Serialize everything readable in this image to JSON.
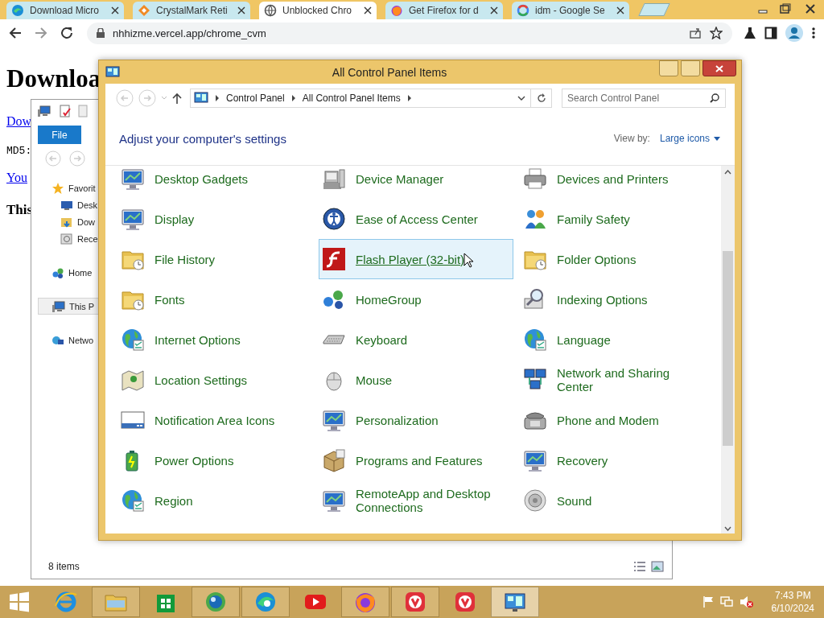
{
  "browser": {
    "tabs": [
      {
        "title": "Download Micro",
        "selected": false
      },
      {
        "title": "CrystalMark Reti",
        "selected": false
      },
      {
        "title": "Unblocked Chro",
        "selected": true
      },
      {
        "title": "Get Firefox for d",
        "selected": false
      },
      {
        "title": "idm - Google Se",
        "selected": false
      }
    ],
    "address": "nhhizme.vercel.app/chrome_cvm"
  },
  "web_page": {
    "heading": "Downloa",
    "link_1": "Dow",
    "md5_label": "MD5:",
    "link_2": "You",
    "bold_text": "This"
  },
  "explorer": {
    "ribbon_tab": "File",
    "nav_items": [
      {
        "label": "Favorit",
        "kind": "group",
        "selected": false
      },
      {
        "label": "Desk",
        "kind": "child",
        "selected": false
      },
      {
        "label": "Dow",
        "kind": "child",
        "selected": false
      },
      {
        "label": "Rece",
        "kind": "child",
        "selected": false
      },
      {
        "label": "Home",
        "kind": "group",
        "selected": false
      },
      {
        "label": "This P",
        "kind": "group",
        "selected": true
      },
      {
        "label": "Netwo",
        "kind": "group",
        "selected": false
      }
    ],
    "status": "8 items"
  },
  "control_panel": {
    "title": "All Control Panel Items",
    "breadcrumb": [
      "Control Panel",
      "All Control Panel Items"
    ],
    "search": {
      "placeholder": "Search Control Panel"
    },
    "heading": "Adjust your computer's settings",
    "view_by_label": "View by:",
    "view_by_value": "Large icons",
    "items": [
      {
        "label": "Desktop Gadgets",
        "selected": false
      },
      {
        "label": "Device Manager",
        "selected": false
      },
      {
        "label": "Devices and Printers",
        "selected": false
      },
      {
        "label": "Display",
        "selected": false
      },
      {
        "label": "Ease of Access Center",
        "selected": false
      },
      {
        "label": "Family Safety",
        "selected": false
      },
      {
        "label": "File History",
        "selected": false
      },
      {
        "label": "Flash Player (32-bit)",
        "selected": true
      },
      {
        "label": "Folder Options",
        "selected": false
      },
      {
        "label": "Fonts",
        "selected": false
      },
      {
        "label": "HomeGroup",
        "selected": false
      },
      {
        "label": "Indexing Options",
        "selected": false
      },
      {
        "label": "Internet Options",
        "selected": false
      },
      {
        "label": "Keyboard",
        "selected": false
      },
      {
        "label": "Language",
        "selected": false
      },
      {
        "label": "Location Settings",
        "selected": false
      },
      {
        "label": "Mouse",
        "selected": false
      },
      {
        "label": "Network and Sharing Center",
        "selected": false
      },
      {
        "label": "Notification Area Icons",
        "selected": false
      },
      {
        "label": "Personalization",
        "selected": false
      },
      {
        "label": "Phone and Modem",
        "selected": false
      },
      {
        "label": "Power Options",
        "selected": false
      },
      {
        "label": "Programs and Features",
        "selected": false
      },
      {
        "label": "Recovery",
        "selected": false
      },
      {
        "label": "Region",
        "selected": false
      },
      {
        "label": "RemoteApp and Desktop Connections",
        "selected": false
      },
      {
        "label": "Sound",
        "selected": false
      }
    ]
  },
  "taskbar": {
    "apps": [
      {
        "running": false,
        "selected": false
      },
      {
        "running": true,
        "selected": false
      },
      {
        "running": false,
        "selected": false
      },
      {
        "running": true,
        "selected": false
      },
      {
        "running": true,
        "selected": false
      },
      {
        "running": false,
        "selected": false
      },
      {
        "running": true,
        "selected": false
      },
      {
        "running": true,
        "selected": false
      },
      {
        "running": false,
        "selected": false
      },
      {
        "running": true,
        "selected": true
      }
    ],
    "time": "7:43 PM",
    "date": "6/10/2024"
  }
}
